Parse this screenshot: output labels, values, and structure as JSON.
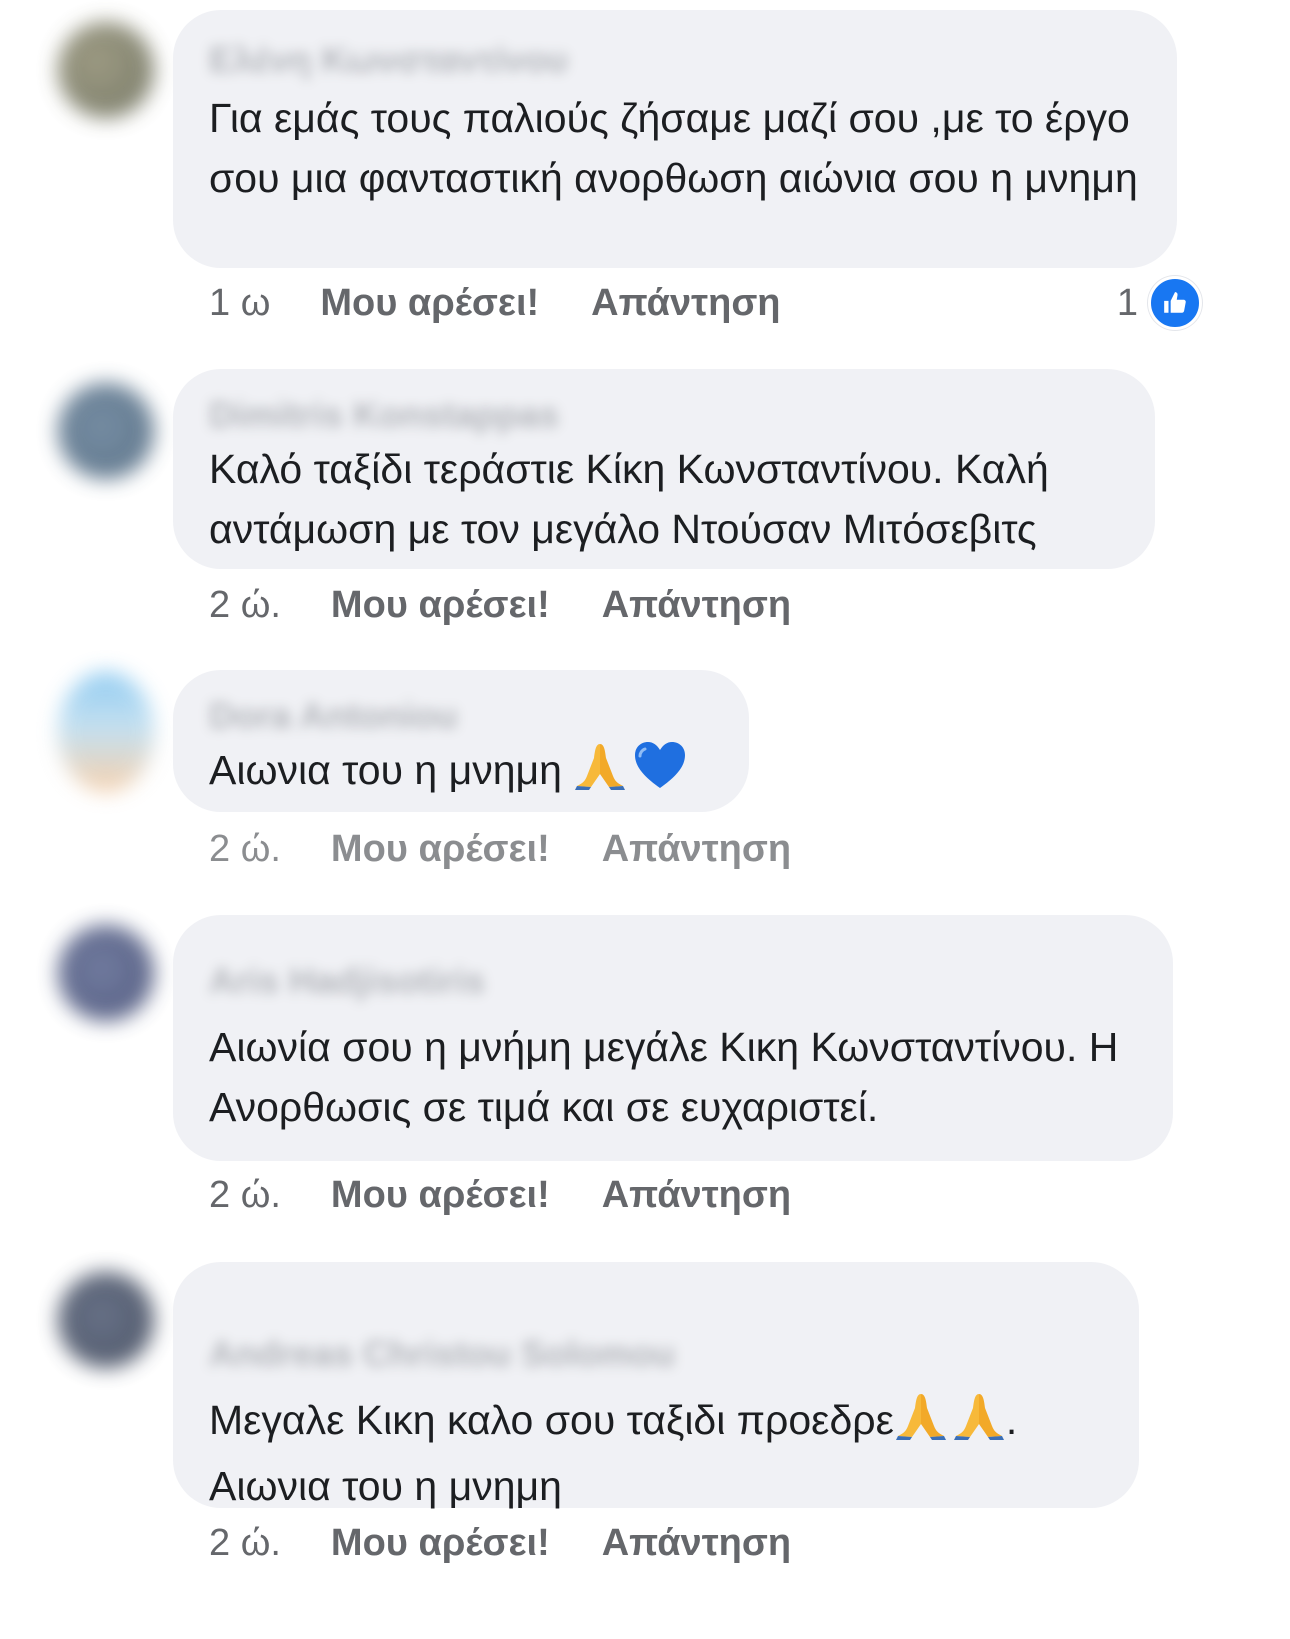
{
  "comments": [
    {
      "author": "Ελένη Κωνσταντίνου",
      "text": "Για εμάς τους παλιούς ζήσαμε μαζί σου ,με το έργο σου μια φανταστική ανορθωση αιώνια σου η μνημη",
      "time": "1 ω",
      "like_label": "Μου αρέσει!",
      "reply_label": "Απάντηση",
      "reaction_count": "1"
    },
    {
      "author": "Dimitris Konstappas",
      "text": "Καλό ταξίδι τεράστιε Κίκη Κωνσταντίνου. Καλή αντάμωση με τον μεγάλο Ντούσαν Μιτόσεβιτς",
      "time": "2 ώ.",
      "like_label": "Μου αρέσει!",
      "reply_label": "Απάντηση"
    },
    {
      "author": "Dora Antoniou",
      "text_main": "Αιωνια του η μνημη ",
      "time": "2 ώ.",
      "like_label": "Μου αρέσει!",
      "reply_label": "Απάντηση"
    },
    {
      "author": "Aris Hadjisotiris",
      "text": "Αιωνία σου η μνήμη μεγάλε Κικη Κωνσταντίνου. Η Ανορθωσις σε τιμά και σε ευχαριστεί.",
      "time": "2 ώ.",
      "like_label": "Μου αρέσει!",
      "reply_label": "Απάντηση"
    },
    {
      "author": "Andreas Christou Solomou",
      "text_line1": "Μεγαλε Κικη  καλο σου ταξιδι  προεδρε",
      "text_line1_end": ".",
      "text_line2": "Αιωνια του η μνημη",
      "time": "2 ώ.",
      "like_label": "Μου αρέσει!",
      "reply_label": "Απάντηση"
    }
  ],
  "icons": {
    "like_badge": "thumbs-up-icon",
    "pray": "folded-hands-icon",
    "heart": "blue-heart-icon"
  },
  "colors": {
    "bubble": "#f0f1f5",
    "meta_text": "#65676b",
    "like_blue": "#1877f2",
    "heart_blue": "#1f6fe0"
  }
}
